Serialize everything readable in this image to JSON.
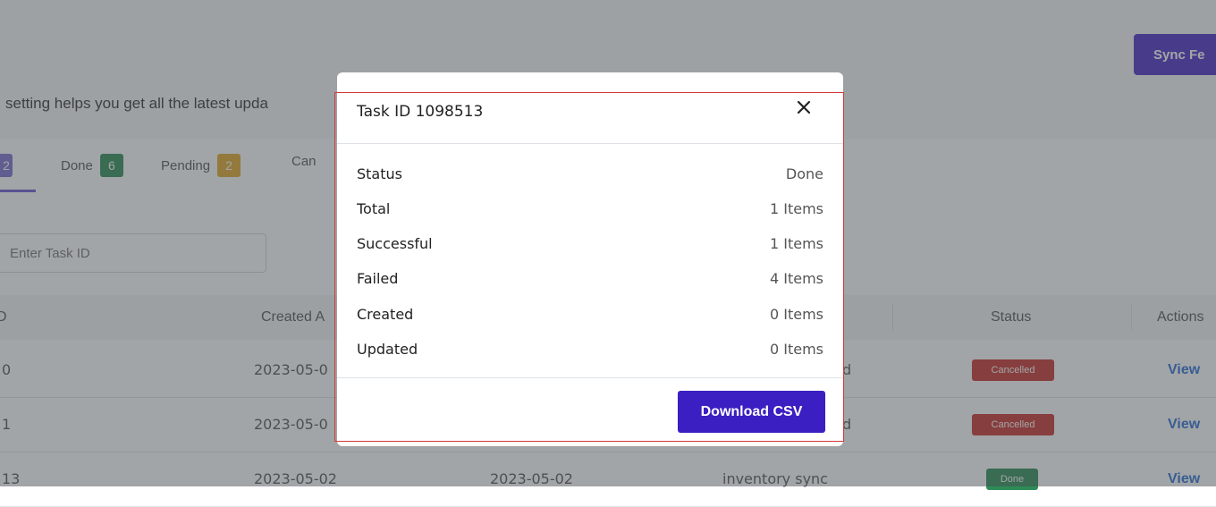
{
  "header": {
    "sync_button_label": "Sync Fe"
  },
  "page": {
    "subtitle": "setting helps you get all the latest upda"
  },
  "tabs": [
    {
      "label": "",
      "count": "2",
      "color": "#7b6fd0"
    },
    {
      "label": "Done",
      "count": "6",
      "color": "#2e8b57"
    },
    {
      "label": "Pending",
      "count": "2",
      "color": "#e0a829"
    },
    {
      "label": "Can",
      "count": "",
      "color": ""
    }
  ],
  "search": {
    "placeholder": "Enter Task ID"
  },
  "table": {
    "columns": [
      "D",
      "Created A",
      "",
      "",
      "Status",
      "Actions"
    ],
    "rows": [
      {
        "id": "0",
        "created": "2023-05-0",
        "updated": "",
        "type": "d",
        "status": "Cancelled",
        "status_color": "#c9302c",
        "action": "View"
      },
      {
        "id": "1",
        "created": "2023-05-0",
        "updated": "",
        "type": "d",
        "status": "Cancelled",
        "status_color": "#c9302c",
        "action": "View"
      },
      {
        "id": "13",
        "created": "2023-05-02",
        "updated": "2023-05-02",
        "type": "inventory sync",
        "status": "Done",
        "status_color": "#2e8b57",
        "action": "View"
      }
    ]
  },
  "modal": {
    "title": "Task ID 1098513",
    "rows": [
      {
        "label": "Status",
        "value": "Done"
      },
      {
        "label": "Total",
        "value": "1 Items"
      },
      {
        "label": "Successful",
        "value": "1 Items"
      },
      {
        "label": "Failed",
        "value": "4 Items"
      },
      {
        "label": "Created",
        "value": "0 Items"
      },
      {
        "label": "Updated",
        "value": "0 Items"
      }
    ],
    "download_label": "Download CSV"
  },
  "colors": {
    "accent": "#3b1fc2",
    "link": "#2b6fd6"
  }
}
